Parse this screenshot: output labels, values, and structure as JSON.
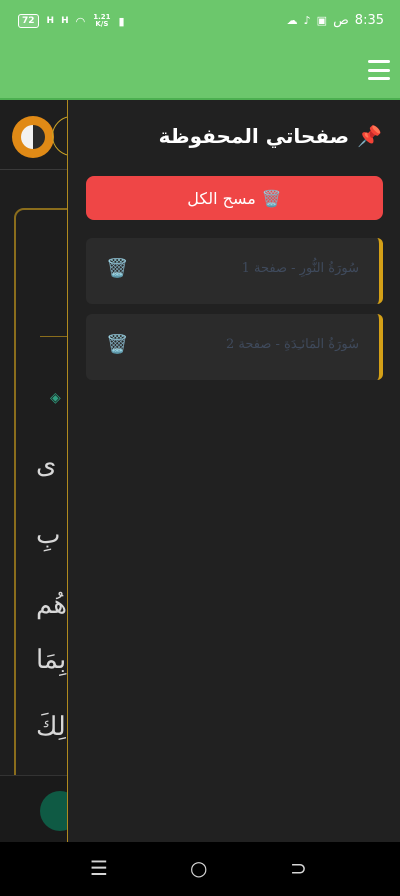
{
  "status_bar": {
    "battery": "72",
    "signal1": "H",
    "signal2": "H",
    "net_speed_value": "1.21",
    "net_speed_unit": "K/S",
    "time": "8:35",
    "ampm": "ص"
  },
  "app_bar": {
    "menu_icon": "menu-icon"
  },
  "underlying_page": {
    "text_fragments": [
      "ى",
      "بِ",
      "هُم",
      "بِمَا",
      "لِكَ"
    ],
    "ornament": "◈"
  },
  "drawer": {
    "title": "صفحاتي المحفوظة",
    "title_icon": "📌",
    "clear_all_label": "مسح الكل",
    "clear_all_icon": "🗑️",
    "items": [
      {
        "label": "سُورَةُ النُّورِ - صفحة 1",
        "delete_icon": "🗑️"
      },
      {
        "label": "سُورَةُ المَائـِدَةِ - صفحة 2",
        "delete_icon": "🗑️"
      }
    ]
  },
  "nav_bar": {
    "recents": "☰",
    "home": "○",
    "back": "⊃"
  },
  "colors": {
    "app_bar": "#6cc76c",
    "drawer_bg": "#212121",
    "clear_button": "#ef4646",
    "item_accent": "#d4a017"
  }
}
